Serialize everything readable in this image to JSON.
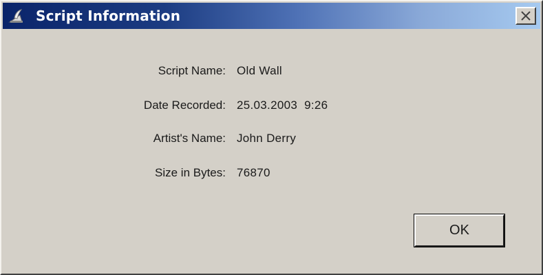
{
  "window": {
    "title": "Script Information"
  },
  "titlebar": {
    "icon": "app-icon",
    "close_icon": "close-icon"
  },
  "info": [
    {
      "label": "Script Name:",
      "value": "Old Wall"
    },
    {
      "label": "Date Recorded:",
      "value": "25.03.2003  9:26"
    },
    {
      "label": "Artist's Name:",
      "value": "John Derry"
    },
    {
      "label": "Size in Bytes:",
      "value": "76870"
    }
  ],
  "buttons": {
    "ok_label": "OK"
  },
  "colors": {
    "titlebar_start": "#0a246a",
    "titlebar_end": "#a6caf0",
    "window_bg": "#d4d0c8"
  }
}
